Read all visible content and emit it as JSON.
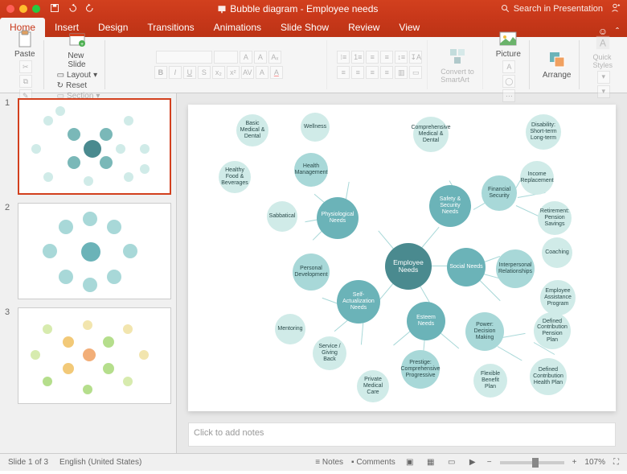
{
  "titlebar": {
    "title": "Bubble diagram - Employee needs",
    "search_placeholder": "Search in Presentation"
  },
  "tabs": [
    "Home",
    "Insert",
    "Design",
    "Transitions",
    "Animations",
    "Slide Show",
    "Review",
    "View"
  ],
  "ribbon": {
    "paste": "Paste",
    "new_slide": "New\nSlide",
    "layout": "Layout",
    "reset": "Reset",
    "section": "Section",
    "convert": "Convert to\nSmartArt",
    "picture": "Picture",
    "arrange": "Arrange",
    "quick_styles": "Quick\nStyles"
  },
  "thumbnails": [
    {
      "num": "1"
    },
    {
      "num": "2"
    },
    {
      "num": "3"
    }
  ],
  "bubbles": {
    "center": "Employee\nNeeds",
    "phys": "Physiological Needs",
    "safety": "Safety &\nSecurity Needs",
    "social": "Social Needs",
    "esteem": "Esteem Needs",
    "self": "Self-Actualization\nNeeds",
    "basic_med": "Basic Medical\n& Dental",
    "wellness": "Wellness",
    "comp_med": "Comprehensive\nMedical\n& Dental",
    "disability": "Disability:\nShort-term\nLong-term",
    "fin_sec": "Financial\nSecurity",
    "income": "Income\nReplacement",
    "retirement": "Retirement:\nPension\nSavings",
    "healthy_food": "Healthy Food\n& Beverages",
    "health_mgmt": "Health\nManagement",
    "sabbatical": "Sabbatical",
    "personal_dev": "Personal\nDevelopment",
    "mentoring": "Mentoring",
    "service": "Service / Giving\nBack",
    "coaching": "Coaching",
    "interpersonal": "Interpersonal\nRelationships",
    "eap": "Employee\nAssistance\nProgram",
    "power": "Power: Decision\nMaking",
    "dcpp": "Defined\nContribution\nPension Plan",
    "dchp": "Defined\nContribution\nHealth Plan",
    "flex": "Flexible\nBenefit Plan",
    "prestige": "Prestige:\nComprehensive\nProgressive",
    "private_med": "Private\nMedical Care"
  },
  "notes_placeholder": "Click to add notes",
  "status": {
    "slide": "Slide 1 of 3",
    "lang": "English (United States)",
    "notes": "Notes",
    "comments": "Comments",
    "zoom": "107%"
  }
}
